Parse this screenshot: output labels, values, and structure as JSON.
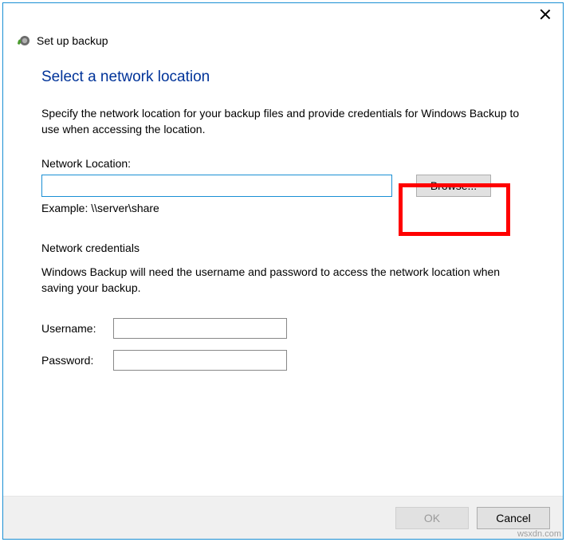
{
  "window": {
    "title": "Set up backup"
  },
  "page": {
    "heading": "Select a network location",
    "instruction": "Specify the network location for your backup files and provide credentials for Windows Backup to use when accessing the location."
  },
  "location": {
    "label": "Network Location:",
    "value": "",
    "browse_label": "Browse...",
    "example": "Example: \\\\server\\share"
  },
  "credentials": {
    "section_label": "Network credentials",
    "instruction": "Windows Backup will need the username and password to access the network location when saving your backup.",
    "username_label": "Username:",
    "username_value": "",
    "password_label": "Password:",
    "password_value": ""
  },
  "footer": {
    "ok_label": "OK",
    "cancel_label": "Cancel"
  },
  "watermark": "wsxdn.com"
}
